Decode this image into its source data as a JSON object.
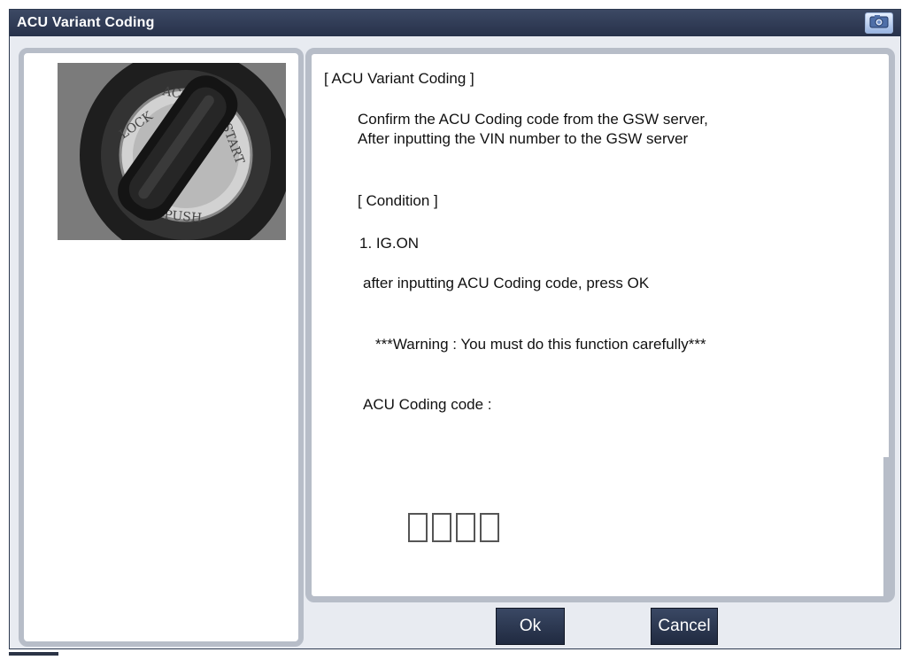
{
  "window": {
    "title": "ACU Variant Coding"
  },
  "content": {
    "heading": "[ ACU Variant Coding ]",
    "instruction_line1": "Confirm the ACU Coding code from the GSW server,",
    "instruction_line2": "After inputting the VIN number to the GSW server",
    "condition_heading": "[ Condition ]",
    "condition_1": "1. IG.ON",
    "step_text": "after inputting ACU Coding code, press OK",
    "warning": "***Warning : You must do this function carefully***",
    "code_label": "ACU Coding code :",
    "code_values": [
      "",
      "",
      "",
      ""
    ]
  },
  "buttons": {
    "ok": "Ok",
    "cancel": "Cancel"
  },
  "icons": {
    "titlebar": "camera-icon",
    "photo": "ignition-switch-photo"
  },
  "colors": {
    "titlebar": "#2f3a55",
    "panel_border": "#b7bdc8",
    "button": "#2b3550"
  }
}
